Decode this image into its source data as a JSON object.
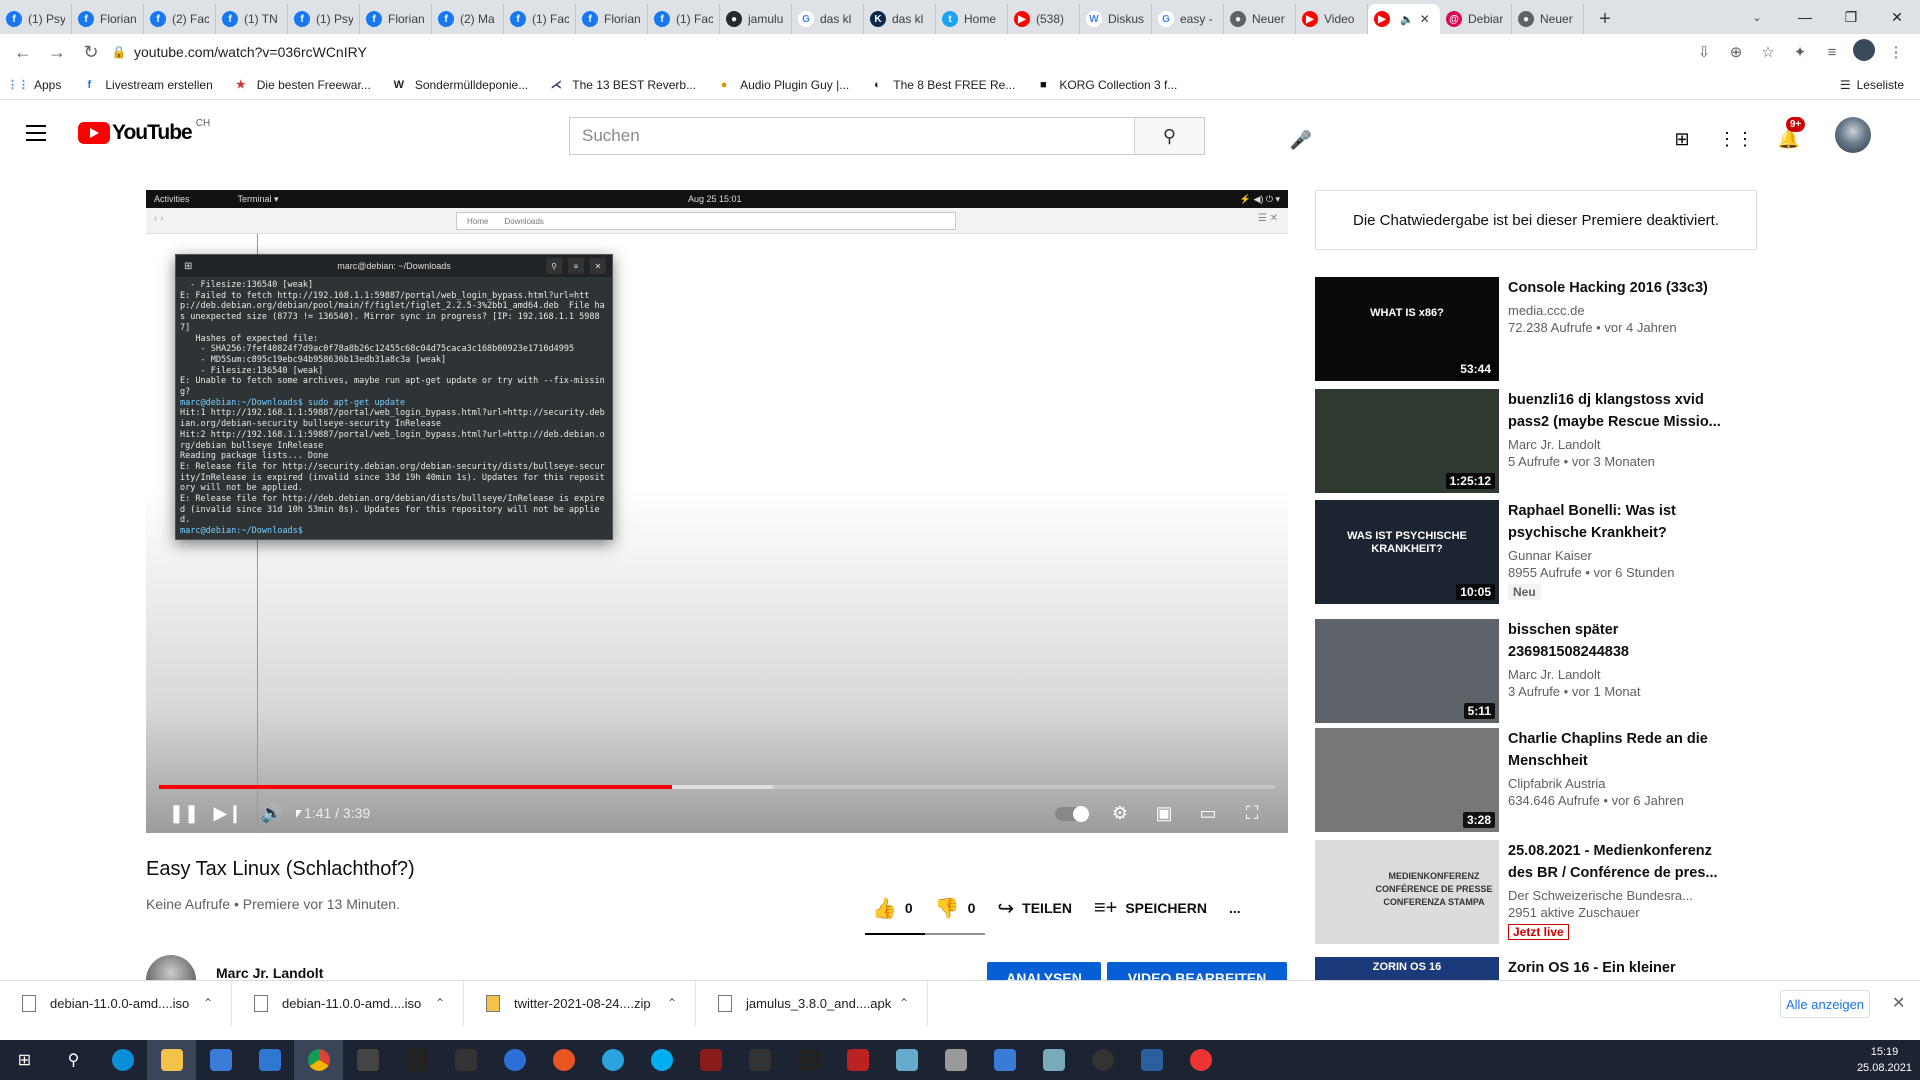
{
  "browser": {
    "tabs": [
      {
        "title": "(1) Psy",
        "icon": "facebook-icon",
        "color": "#1877f2",
        "glyph": "f"
      },
      {
        "title": "Florian",
        "icon": "facebook-icon",
        "color": "#1877f2",
        "glyph": "f"
      },
      {
        "title": "(2) Fac",
        "icon": "facebook-icon",
        "color": "#1877f2",
        "glyph": "f"
      },
      {
        "title": "(1) TN",
        "icon": "facebook-icon",
        "color": "#1877f2",
        "glyph": "f"
      },
      {
        "title": "(1) Psy",
        "icon": "facebook-icon",
        "color": "#1877f2",
        "glyph": "f"
      },
      {
        "title": "Florian",
        "icon": "facebook-icon",
        "color": "#1877f2",
        "glyph": "f"
      },
      {
        "title": "(2) Ma",
        "icon": "facebook-icon",
        "color": "#1877f2",
        "glyph": "f"
      },
      {
        "title": "(1) Fac",
        "icon": "facebook-icon",
        "color": "#1877f2",
        "glyph": "f"
      },
      {
        "title": "Florian",
        "icon": "facebook-icon",
        "color": "#1877f2",
        "glyph": "f"
      },
      {
        "title": "(1) Fac",
        "icon": "facebook-icon",
        "color": "#1877f2",
        "glyph": "f"
      },
      {
        "title": "jamulu",
        "icon": "github-icon",
        "color": "#24292e",
        "glyph": "●"
      },
      {
        "title": "das kl",
        "icon": "google-icon",
        "color": "#ffffff",
        "glyph": "G"
      },
      {
        "title": "das kl",
        "icon": "k-icon",
        "color": "#0b2a4a",
        "glyph": "K"
      },
      {
        "title": "Home",
        "icon": "twitter-icon",
        "color": "#1da1f2",
        "glyph": "t"
      },
      {
        "title": "(538)",
        "icon": "youtube-icon",
        "color": "#ff0000",
        "glyph": "▶"
      },
      {
        "title": "Diskus",
        "icon": "wikipedia-icon",
        "color": "#ffffff",
        "glyph": "W"
      },
      {
        "title": "easy -",
        "icon": "google-icon",
        "color": "#ffffff",
        "glyph": "G"
      },
      {
        "title": "Neuer",
        "icon": "chrome-icon",
        "color": "#5f6368",
        "glyph": "●"
      },
      {
        "title": "Video",
        "icon": "youtube-icon",
        "color": "#ff0000",
        "glyph": "▶"
      },
      {
        "title": "",
        "icon": "youtube-icon",
        "color": "#ff0000",
        "glyph": "▶",
        "active": true
      },
      {
        "title": "Debiar",
        "icon": "debian-icon",
        "color": "#d70a53",
        "glyph": "@"
      },
      {
        "title": "Neuer",
        "icon": "chrome-icon",
        "color": "#5f6368",
        "glyph": "●"
      }
    ],
    "url": "youtube.com/watch?v=036rcWCnIRY",
    "bookmarks": [
      {
        "label": "Apps",
        "icon": "apps-grid-icon"
      },
      {
        "label": "Livestream erstellen",
        "icon": "facebook-icon"
      },
      {
        "label": "Die besten Freewar...",
        "icon": "star-icon"
      },
      {
        "label": "Sondermülldeponie...",
        "icon": "w-icon"
      },
      {
        "label": "The 13 BEST Reverb...",
        "icon": "audio-icon"
      },
      {
        "label": "Audio Plugin Guy |...",
        "icon": "plugin-icon"
      },
      {
        "label": "The 8 Best FREE Re...",
        "icon": "moon-icon"
      },
      {
        "label": "KORG Collection 3 f...",
        "icon": "korg-icon"
      }
    ],
    "reading_list": "Leseliste"
  },
  "youtube": {
    "logo_word": "YouTube",
    "country": "CH",
    "search_placeholder": "Suchen",
    "notif_count": "9+"
  },
  "player": {
    "desktop_activities": "Activities",
    "desktop_terminal": "Terminal ▾",
    "desktop_clock": "Aug 25  15:01",
    "fm_home": "Home",
    "fm_downloads": "Downloads",
    "terminal_title": "marc@debian: ~/Downloads",
    "terminal_lines": [
      "  - Filesize:136540 [weak]",
      "E: Failed to fetch http://192.168.1.1:59887/portal/web_login_bypass.html?url=http://deb.debian.org/debian/pool/main/f/figlet/figlet_2.2.5-3%2bb1_amd64.deb  File has unexpected size (8773 != 136540). Mirror sync in progress? [IP: 192.168.1.1 59887]",
      "   Hashes of expected file:",
      "    - SHA256:7fef40824f7d9ac0f78a8b26c12455c68c04d75caca3c168b00923e1710d4995",
      "    - MD5Sum:c895c19ebc94b958636b13edb31a8c3a [weak]",
      "    - Filesize:136540 [weak]",
      "E: Unable to fetch some archives, maybe run apt-get update or try with --fix-missing?",
      "marc@debian:~/Downloads$ sudo apt-get update",
      "Hit:1 http://192.168.1.1:59887/portal/web_login_bypass.html?url=http://security.debian.org/debian-security bullseye-security InRelease",
      "Hit:2 http://192.168.1.1:59887/portal/web_login_bypass.html?url=http://deb.debian.org/debian bullseye InRelease",
      "Reading package lists... Done",
      "E: Release file for http://security.debian.org/debian-security/dists/bullseye-security/InRelease is expired (invalid since 33d 19h 40min 1s). Updates for this repository will not be applied.",
      "E: Release file for http://deb.debian.org/debian/dists/bullseye/InRelease is expired (invalid since 31d 10h 53min 8s). Updates for this repository will not be applied.",
      "marc@debian:~/Downloads$"
    ],
    "time": "1:41 / 3:39",
    "progress_played": 0.46,
    "progress_buffered": 0.55
  },
  "video": {
    "title": "Easy Tax Linux (Schlachthof?)",
    "meta": "Keine Aufrufe • Premiere vor 13 Minuten.",
    "likes": "0",
    "dislikes": "0",
    "share": "TEILEN",
    "save": "SPEICHERN",
    "more": "...",
    "channel": "Marc Jr. Landolt",
    "btn_analytics": "ANALYSEN",
    "btn_edit": "VIDEO BEARBEITEN"
  },
  "sidebar": {
    "chat_notice": "Die Chatwiedergabe ist bei dieser Premiere deaktiviert.",
    "recommendations": [
      {
        "title": "Console Hacking 2016 (33c3)",
        "channel": "media.ccc.de",
        "stats": "72.238 Aufrufe • vor 4 Jahren",
        "duration": "53:44",
        "thumb_text": "WHAT IS x86?",
        "thumb_bg": "#0a0a0a"
      },
      {
        "title": "buenzli16 dj klangstoss xvid pass2 (maybe Rescue Missio...",
        "channel": "Marc Jr. Landolt",
        "stats": "5 Aufrufe • vor 3 Monaten",
        "duration": "1:25:12",
        "thumb_text": "",
        "thumb_bg": "#2e3a30"
      },
      {
        "title": "Raphael Bonelli: Was ist psychische Krankheit?",
        "channel": "Gunnar Kaiser",
        "stats": "8955 Aufrufe • vor 6 Stunden",
        "duration": "10:05",
        "thumb_text": "WAS IST PSYCHISCHE KRANKHEIT?",
        "thumb_bg": "#1b2430",
        "badge": "Neu"
      },
      {
        "title": "bisschen später 236981508244838",
        "channel": "Marc Jr. Landolt",
        "stats": "3 Aufrufe • vor 1 Monat",
        "duration": "5:11",
        "thumb_text": "",
        "thumb_bg": "#5d6368"
      },
      {
        "title": "Charlie Chaplins Rede an die Menschheit",
        "channel": "Clipfabrik Austria",
        "stats": "634.646 Aufrufe • vor 6 Jahren",
        "duration": "3:28",
        "thumb_text": "",
        "thumb_bg": "#777777"
      },
      {
        "title": "25.08.2021 - Medienkonferenz des BR / Conférence de pres...",
        "channel": "Der Schweizerische Bundesra...",
        "stats": "2951 aktive Zuschauer",
        "duration": "",
        "thumb_text": "MEDIENKONFERENZ CONFÉRENCE DE PRESSE CONFERENZA STAMPA",
        "thumb_bg": "#dcdcdc",
        "live": "Jetzt live"
      },
      {
        "title": "Zorin OS 16 - Ein kleiner",
        "channel": "",
        "stats": "",
        "duration": "",
        "thumb_text": "ZORIN OS 16",
        "thumb_bg": "#1b3a7a"
      }
    ]
  },
  "downloads": {
    "items": [
      "debian-11.0.0-amd....iso",
      "debian-11.0.0-amd....iso",
      "twitter-2021-08-24....zip",
      "jamulus_3.8.0_and....apk"
    ],
    "show_all": "Alle anzeigen"
  },
  "taskbar": {
    "time": "15:19",
    "date": "25.08.2021"
  },
  "colors": {
    "accent_red": "#ff0000",
    "blue": "#065fd4",
    "link_blue": "#1a73e8"
  }
}
